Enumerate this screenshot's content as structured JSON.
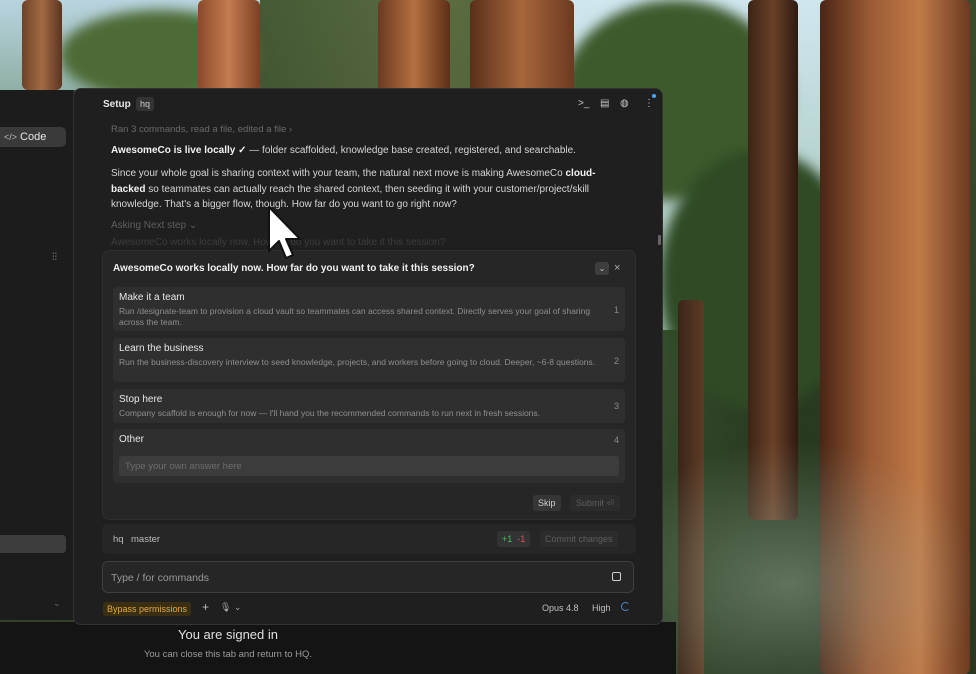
{
  "left_panel": {
    "code_button": "Code"
  },
  "chat": {
    "header": {
      "title": "Setup",
      "badge": "hq"
    },
    "tool_summary": "Ran 3 commands, read a file, edited a file ›",
    "message1": {
      "bold": "AwesomeCo is live locally ✓",
      "rest": " — folder scaffolded, knowledge base created, registered, and searchable."
    },
    "message2": {
      "part1": "Since your whole goal is sharing context with your team, the natural next move is making AwesomeCo ",
      "bold": "cloud-backed",
      "part2": " so teammates can actually reach the shared context, then seeding it with your customer/project/skill knowledge. That's a bigger flow, though. How far do you want to go right now?"
    },
    "asking": "Asking Next step ⌄",
    "faded_line": "AwesomeCo works locally now. How far do you want to take it this session?",
    "question": {
      "title": "AwesomeCo works locally now. How far do you want to take it this session?",
      "options": [
        {
          "label": "Make it a team",
          "description": "Run /designate-team to provision a cloud vault so teammates can access shared context. Directly serves your goal of sharing across the team.",
          "number": "1"
        },
        {
          "label": "Learn the business",
          "description": "Run the business-discovery interview to seed knowledge, projects, and workers before going to cloud. Deeper, ~6-8 questions.",
          "number": "2"
        },
        {
          "label": "Stop here",
          "description": "Company scaffold is enough for now — I'll hand you the recommended commands to run next in fresh sessions.",
          "number": "3"
        },
        {
          "label": "Other",
          "number": "4",
          "placeholder": "Type your own answer here"
        }
      ],
      "skip_label": "Skip",
      "submit_label": "Submit ⏎"
    },
    "branch_bar": {
      "workspace": "hq",
      "branch": "master",
      "additions": "+1",
      "deletions": "-1",
      "commit_label": "Commit changes"
    },
    "command_input": {
      "placeholder": "Type / for commands"
    },
    "footer": {
      "bypass_label": "Bypass permissions",
      "plus": "+",
      "mic": "🎙 ⌄",
      "model": "Opus 4.8",
      "effort": "High"
    }
  },
  "bottom_page": {
    "title": "You are signed in",
    "subtitle": "You can close this tab and return to HQ."
  },
  "colors": {
    "panel_bg": "#1f1f1f",
    "card_bg": "#262626",
    "bypass_accent": "#e6a740",
    "diff_add": "#4bc25b",
    "diff_del": "#e05252"
  }
}
